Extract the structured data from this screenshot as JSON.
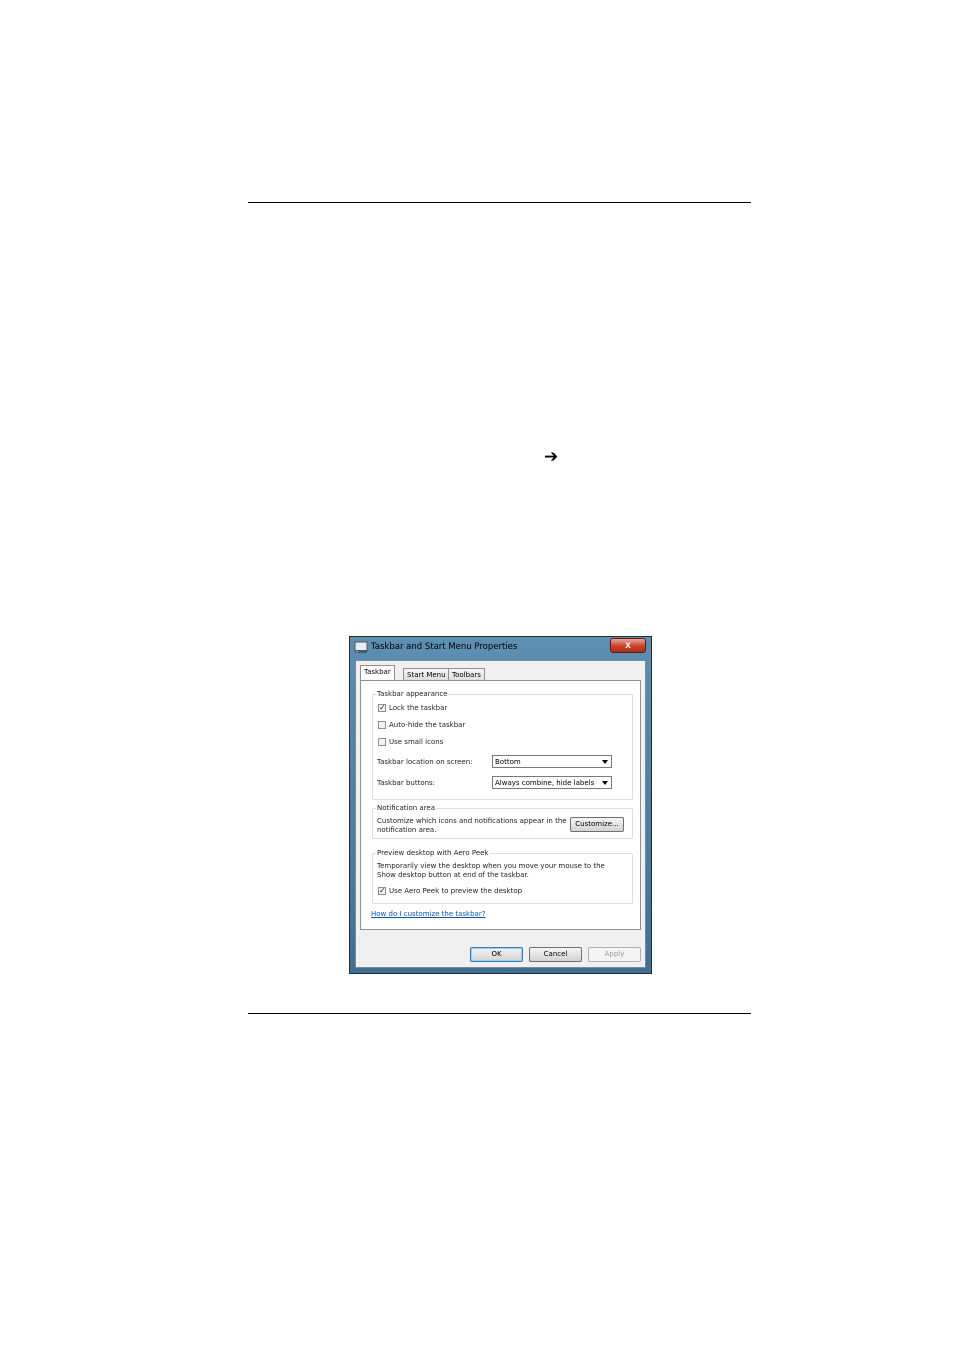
{
  "page": {
    "arrow_glyph": "➔"
  },
  "dialog": {
    "title": "Taskbar and Start Menu Properties",
    "close_glyph": "x",
    "tabs": [
      {
        "label": "Taskbar"
      },
      {
        "label": "Start Menu"
      },
      {
        "label": "Toolbars"
      }
    ],
    "taskbar_appearance": {
      "title": "Taskbar appearance",
      "lock_taskbar": {
        "label": "Lock the taskbar",
        "checked": true
      },
      "auto_hide": {
        "label": "Auto-hide the taskbar",
        "checked": false
      },
      "small_icons": {
        "label": "Use small icons",
        "checked": false
      },
      "location": {
        "label": "Taskbar location on screen:",
        "value": "Bottom"
      },
      "buttons": {
        "label": "Taskbar buttons:",
        "value": "Always combine, hide labels"
      }
    },
    "notification_area": {
      "title": "Notification area",
      "line1": "Customize which icons and notifications appear in the",
      "line2": "notification area.",
      "customize_label": "Customize..."
    },
    "aero_peek": {
      "title": "Preview desktop with Aero Peek",
      "line1": "Temporarily view the desktop when you move your mouse to the",
      "line2": "Show desktop button at end of the taskbar.",
      "use_aero_peek": {
        "label": "Use Aero Peek to preview the desktop",
        "checked": true
      }
    },
    "help_link": "How do I customize the taskbar?",
    "buttons": {
      "ok": "OK",
      "cancel": "Cancel",
      "apply": "Apply"
    },
    "check_glyph": "✓"
  }
}
